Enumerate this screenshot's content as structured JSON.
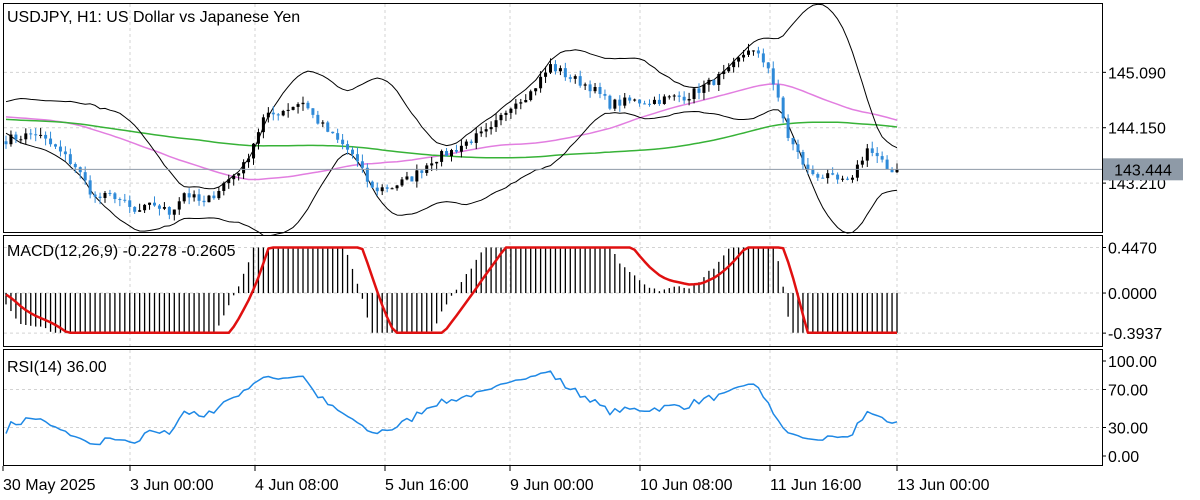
{
  "chart_data": [
    {
      "type": "candlestick",
      "panel": "price",
      "title": "USDJPY, H1:  US Dollar vs Japanese Yen",
      "y_ticks": [
        145.09,
        144.15,
        143.21
      ],
      "y_tick_labels": [
        "145.090",
        "144.150",
        "143.210"
      ],
      "ylim": [
        142.38,
        146.25
      ],
      "current_price": 143.444,
      "current_price_label": "143.444",
      "bar_count": 163,
      "anchors": [
        [
          0,
          143.95
        ],
        [
          6,
          144.05
        ],
        [
          10,
          143.8
        ],
        [
          14,
          143.5
        ],
        [
          18,
          142.95
        ],
        [
          22,
          143.0
        ],
        [
          26,
          142.7
        ],
        [
          30,
          142.85
        ],
        [
          33,
          142.7
        ],
        [
          36,
          143.05
        ],
        [
          40,
          142.85
        ],
        [
          44,
          143.2
        ],
        [
          48,
          143.5
        ],
        [
          52,
          144.3
        ],
        [
          56,
          144.45
        ],
        [
          60,
          144.6
        ],
        [
          62,
          144.35
        ],
        [
          66,
          144.0
        ],
        [
          70,
          143.7
        ],
        [
          74,
          143.1
        ],
        [
          78,
          143.15
        ],
        [
          82,
          143.3
        ],
        [
          86,
          143.6
        ],
        [
          90,
          143.75
        ],
        [
          94,
          143.95
        ],
        [
          98,
          144.1
        ],
        [
          102,
          144.55
        ],
        [
          106,
          144.75
        ],
        [
          110,
          145.2
        ],
        [
          114,
          145.0
        ],
        [
          118,
          144.85
        ],
        [
          122,
          144.55
        ],
        [
          126,
          144.6
        ],
        [
          130,
          144.6
        ],
        [
          134,
          144.65
        ],
        [
          138,
          144.7
        ],
        [
          142,
          144.9
        ],
        [
          146,
          145.1
        ],
        [
          150,
          145.5
        ],
        [
          154,
          145.2
        ],
        [
          158,
          144.0
        ],
        [
          162,
          143.4
        ],
        [
          166,
          143.3
        ],
        [
          170,
          143.2
        ],
        [
          174,
          143.8
        ],
        [
          178,
          143.45
        ],
        [
          180,
          143.44
        ]
      ],
      "overlays": [
        {
          "name": "MA slow",
          "color": "#e27ee0"
        },
        {
          "name": "MA 200",
          "color": "#37b237"
        },
        {
          "name": "Bollinger Bands",
          "color": "#000000"
        }
      ],
      "colors": {
        "up": "#000000",
        "down": "#2f8ad8",
        "grid": "#d3d3d3"
      }
    },
    {
      "type": "macd",
      "panel": "macd",
      "title": "MACD(12,26,9) -0.2278 -0.2605",
      "params": [
        12,
        26,
        9
      ],
      "main": -0.2278,
      "signal": -0.2605,
      "y_ticks": [
        0.447,
        0.0,
        -0.3937
      ],
      "y_tick_labels": [
        "0.4470",
        "0.0000",
        "-0.3937"
      ],
      "ylim": [
        -0.52,
        0.56
      ],
      "signal_color": "#e01010",
      "histogram_color": "#000000"
    },
    {
      "type": "line",
      "panel": "rsi",
      "title": "RSI(14) 36.00",
      "period": 14,
      "last": 36.0,
      "y_ticks": [
        100,
        70,
        30,
        0
      ],
      "y_tick_labels": [
        "100.00",
        "70.00",
        "30.00",
        "0.00"
      ],
      "ylim": [
        0,
        100
      ],
      "color": "#1e88e5"
    }
  ],
  "x_axis": {
    "labels": [
      "30 May 2025",
      "3 Jun 00:00",
      "4 Jun 08:00",
      "5 Jun 16:00",
      "9 Jun 00:00",
      "10 Jun 08:00",
      "11 Jun 16:00",
      "13 Jun 00:00"
    ],
    "label_bar_index": [
      0,
      32,
      64,
      96,
      128,
      160,
      192,
      224
    ]
  }
}
